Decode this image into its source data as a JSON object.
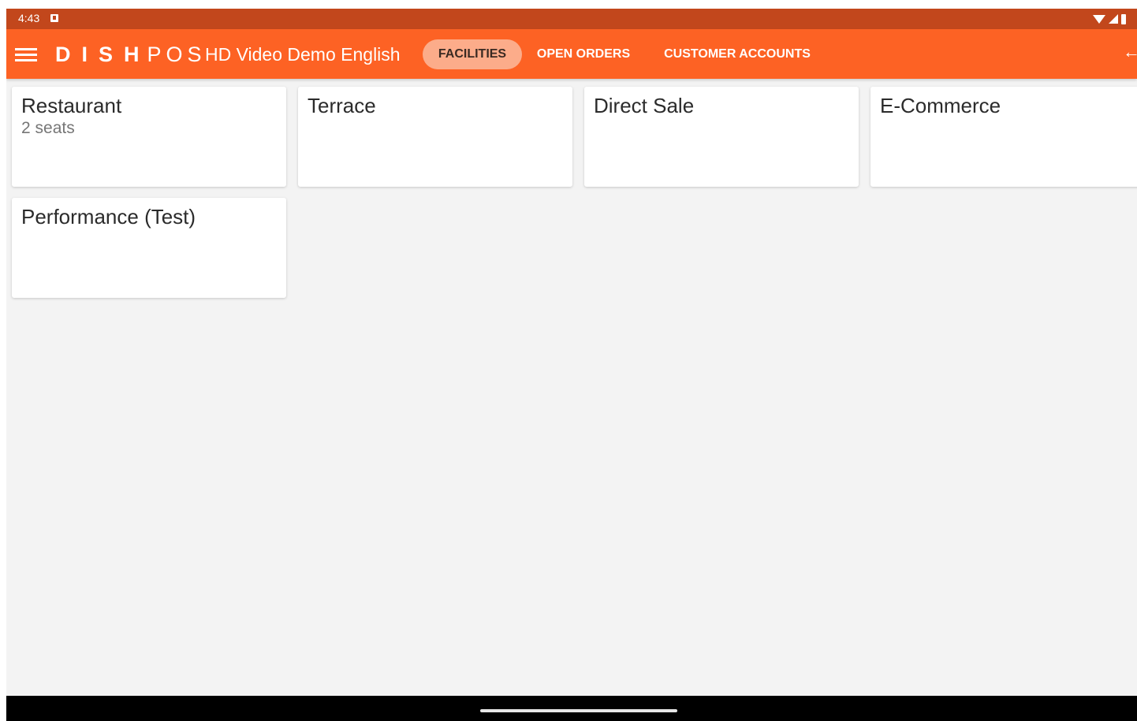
{
  "status_bar": {
    "time": "4:43"
  },
  "app_bar": {
    "logo_dish": "DISH",
    "logo_pos": "POS",
    "venue_name": "HD Video Demo English",
    "tabs": [
      {
        "label": "FACILITIES",
        "active": true
      },
      {
        "label": "OPEN ORDERS",
        "active": false
      },
      {
        "label": "CUSTOMER ACCOUNTS",
        "active": false
      }
    ]
  },
  "facilities": [
    {
      "name": "Restaurant",
      "subtitle": "2 seats"
    },
    {
      "name": "Terrace",
      "subtitle": ""
    },
    {
      "name": "Direct Sale",
      "subtitle": ""
    },
    {
      "name": "E-Commerce",
      "subtitle": ""
    },
    {
      "name": "Performance (Test)",
      "subtitle": ""
    }
  ],
  "colors": {
    "app_bar": "#fd6224",
    "status_bar": "#c2471c",
    "active_tab": "#fcac8a",
    "background": "#f3f3f3"
  },
  "icons": {
    "menu": "menu-icon",
    "back": "back-arrow-icon",
    "wifi": "wifi-icon",
    "signal": "signal-icon",
    "battery": "battery-icon"
  }
}
